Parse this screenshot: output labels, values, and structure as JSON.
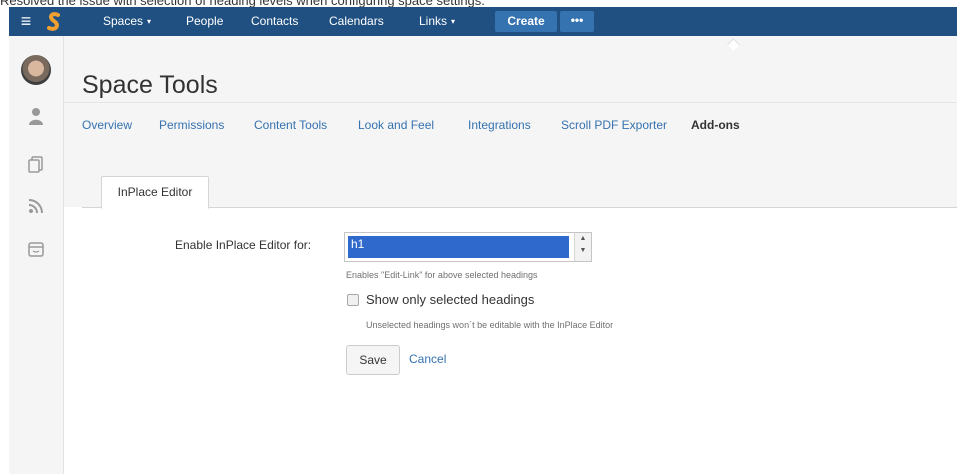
{
  "caption": "Resolved the issue with selection of heading levels when configuring space settings.",
  "topbar": {
    "nav": [
      {
        "label": "Spaces",
        "dropdown": true
      },
      {
        "label": "People",
        "dropdown": false
      },
      {
        "label": "Contacts",
        "dropdown": false
      },
      {
        "label": "Calendars",
        "dropdown": false
      },
      {
        "label": "Links",
        "dropdown": true
      }
    ],
    "create_label": "Create",
    "more_label": "•••",
    "caret": "▾",
    "menu_glyph": "≡"
  },
  "sidebar": {
    "icons": [
      "user-icon",
      "pages-icon",
      "rss-icon",
      "calendar-icon"
    ]
  },
  "header": {
    "title": "Space Tools"
  },
  "tabs": [
    {
      "label": "Overview",
      "active": false
    },
    {
      "label": "Permissions",
      "active": false
    },
    {
      "label": "Content Tools",
      "active": false
    },
    {
      "label": "Look and Feel",
      "active": false
    },
    {
      "label": "Integrations",
      "active": false
    },
    {
      "label": "Scroll PDF Exporter",
      "active": false
    },
    {
      "label": "Add-ons",
      "active": true
    }
  ],
  "inner_tab": {
    "label": "InPlace Editor"
  },
  "form": {
    "enable_label": "Enable InPlace Editor for:",
    "select_value": "h1",
    "select_help": "Enables \"Edit-Link\" for above selected headings",
    "checkbox_label": "Show only selected headings",
    "checkbox_checked": false,
    "checkbox_help": "Unselected headings won´t be editable with the InPlace Editor",
    "save_label": "Save",
    "cancel_label": "Cancel"
  },
  "colors": {
    "topbar": "#205081",
    "button_blue": "#3572b0",
    "link": "#3572b0",
    "selection": "#2f69cc"
  }
}
